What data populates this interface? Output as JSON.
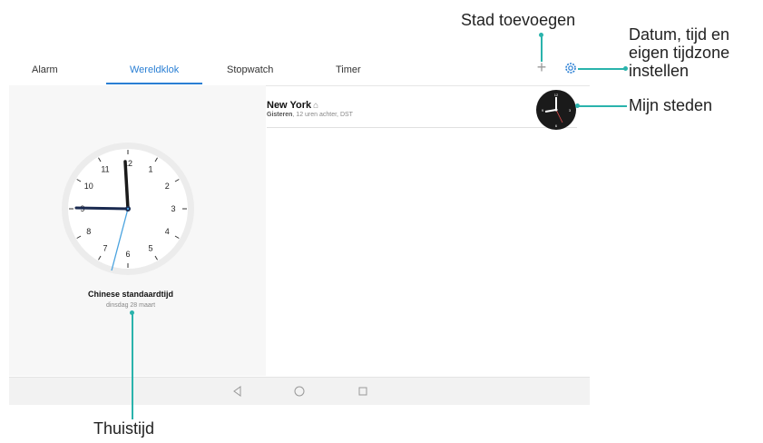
{
  "tabs": [
    "Alarm",
    "Wereldklok",
    "Stopwatch",
    "Timer"
  ],
  "active_tab": "Wereldklok",
  "accent_color": "#2a7fd4",
  "callout_color": "#2ab3ac",
  "world_city": {
    "name": "New York",
    "day": "Gisteren",
    "offset": ", 12 uren achter, DST"
  },
  "home_clock": {
    "timezone": "Chinese standaardtijd",
    "date": "dinsdag 28 maart",
    "numbers": [
      "12",
      "1",
      "2",
      "3",
      "4",
      "5",
      "6",
      "7",
      "8",
      "9",
      "10",
      "11"
    ]
  },
  "annotations": {
    "add_city": "Stad toevoegen",
    "settings_1": "Datum, tijd en",
    "settings_2": "eigen tijdzone",
    "settings_3": "instellen",
    "my_cities": "Mijn steden",
    "home_time": "Thuistijd"
  },
  "icons": {
    "add": "plus-icon",
    "settings": "gear-icon",
    "home": "home-icon",
    "back": "back-triangle-icon",
    "homebtn": "circle-home-icon",
    "recents": "square-recents-icon"
  }
}
